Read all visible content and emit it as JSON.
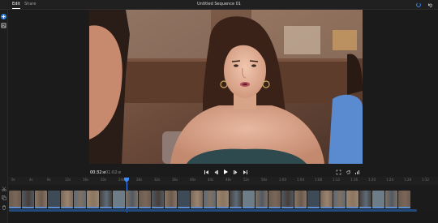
{
  "tabs": [
    {
      "label": "Edit",
      "active": true
    },
    {
      "label": "Share",
      "active": false
    }
  ],
  "sequence_title": "Untitled Sequence 01",
  "left_rail": {
    "icons": [
      "add-icon",
      "media-icon"
    ],
    "accent": "#2680eb"
  },
  "top_right_icons": [
    "sync-status-icon",
    "undo-icon"
  ],
  "timecode": {
    "current": "00:32:e",
    "total": "01:02:e"
  },
  "transport_icons": [
    "go-to-start-icon",
    "step-back-icon",
    "play-icon",
    "step-forward-icon",
    "go-to-end-icon"
  ],
  "viewer_controls": [
    "fit-icon",
    "loop-icon",
    "volume-icon"
  ],
  "ruler_labels": [
    "0s",
    "4s",
    "8s",
    "12s",
    "16s",
    "20s",
    "24s",
    "28s",
    "32s",
    "36s",
    "40s",
    "44s",
    "48s",
    "52s",
    "56s",
    "1:00",
    "1:04",
    "1:08",
    "1:12",
    "1:16",
    "1:20",
    "1:24",
    "1:28",
    "1:32"
  ],
  "timeline_tools": [
    "scissors-icon",
    "copy-icon",
    "trash-icon"
  ],
  "playhead_color": "#3d8bfd",
  "clip_count": 31
}
